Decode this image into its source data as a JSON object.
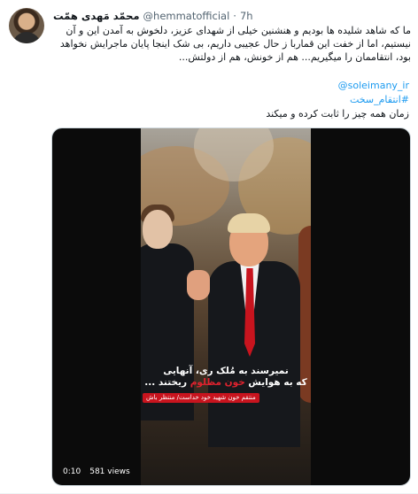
{
  "tweet": {
    "display_name": "محمّد مَهدی همّت",
    "handle": "@hemmatofficial",
    "separator": "·",
    "time": "7h",
    "text": "ما که شاهد شلیده ها بودیم و هنشنین خیلی از شهدای عزیز، دلخوش به آمدن این و آن نیستیم، اما از خفت این قماربا ز حال عجیبی داریم، بی شک اینجا پایان ماجرایش نخواهد بود، انتقاممان را میگیریم... هم از خونش، هم از دولتش...",
    "mention": "@soleimany_ir",
    "hashtag": "#انتقام_سخت",
    "text2": "زمان همه چیز را ثابت کرده و میکند"
  },
  "video": {
    "caption_line1": "نمیرسند به مُلک ری، آنهایی",
    "caption_line2_pre": "که به هوایش",
    "caption_highlight": "خون مظلوم",
    "caption_line2_post": "ریختند ...",
    "tag": "منتقم خون شهید خود خداست/ منتظر باش",
    "duration": "0:10",
    "views": "581 views"
  }
}
